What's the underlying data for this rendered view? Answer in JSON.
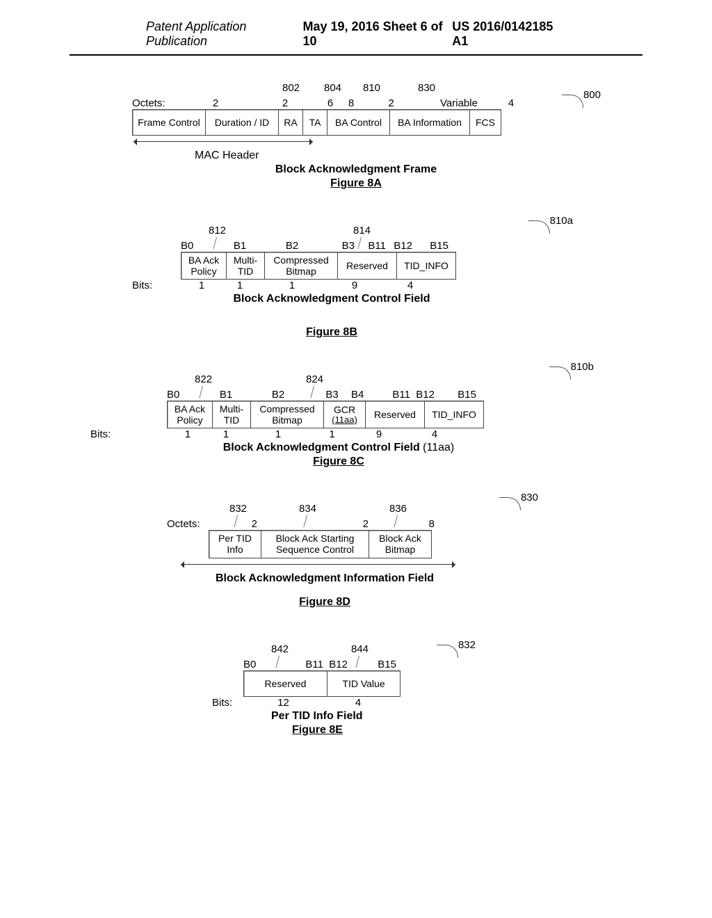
{
  "header": {
    "left": "Patent Application Publication",
    "mid": "May 19, 2016  Sheet 6 of 10",
    "right": "US 2016/0142185 A1"
  },
  "fig8A": {
    "ref_main": "800",
    "callouts": [
      "802",
      "804",
      "810",
      "830"
    ],
    "octets_label": "Octets:",
    "octets": [
      "2",
      "2",
      "6",
      "8",
      "2",
      "Variable",
      "4"
    ],
    "cells": [
      "Frame Control",
      "Duration / ID",
      "RA",
      "TA",
      "BA Control",
      "BA Information",
      "FCS"
    ],
    "arrow_label": "MAC Header",
    "title": "Block Acknowledgment Frame",
    "fig": "Figure 8A"
  },
  "fig8B": {
    "ref_main": "810a",
    "callouts": [
      "812",
      "814"
    ],
    "bitpos": [
      "B0",
      "B1",
      "B2",
      "B3",
      "B11",
      "B12",
      "B15"
    ],
    "cells": [
      "BA Ack\nPolicy",
      "Multi-\nTID",
      "Compressed\nBitmap",
      "Reserved",
      "TID_INFO"
    ],
    "bits_label": "Bits:",
    "bits": [
      "1",
      "1",
      "1",
      "9",
      "4"
    ],
    "title": "Block Acknowledgment Control Field",
    "fig": "Figure 8B"
  },
  "fig8C": {
    "ref_main": "810b",
    "callouts": [
      "822",
      "824"
    ],
    "bitpos": [
      "B0",
      "B1",
      "B2",
      "B3",
      "B4",
      "B11",
      "B12",
      "B15"
    ],
    "cells_pre": [
      "BA Ack\nPolicy",
      "Multi-\nTID",
      "Compressed\nBitmap"
    ],
    "cell_gcr_top": "GCR",
    "cell_gcr_bot": "(11aa)",
    "cells_post": [
      "Reserved",
      "TID_INFO"
    ],
    "bits_label": "Bits:",
    "bits": [
      "1",
      "1",
      "1",
      "1",
      "9",
      "4"
    ],
    "title_bold": "Block Acknowledgment Control Field",
    "title_rest": " (11aa)",
    "fig": "Figure 8C"
  },
  "fig8D": {
    "ref_main": "830",
    "callouts": [
      "832",
      "834",
      "836"
    ],
    "octets_label": "Octets:",
    "octets": [
      "2",
      "2",
      "8"
    ],
    "cells": [
      "Per TID\nInfo",
      "Block Ack Starting\nSequence Control",
      "Block Ack\nBitmap"
    ],
    "title": "Block Acknowledgment Information Field",
    "fig": "Figure 8D"
  },
  "fig8E": {
    "ref_main": "832",
    "callouts": [
      "842",
      "844"
    ],
    "bitpos": [
      "B0",
      "B11",
      "B12",
      "B15"
    ],
    "cells": [
      "Reserved",
      "TID Value"
    ],
    "bits_label": "Bits:",
    "bits": [
      "12",
      "4"
    ],
    "title": "Per TID Info Field",
    "fig": "Figure 8E"
  }
}
